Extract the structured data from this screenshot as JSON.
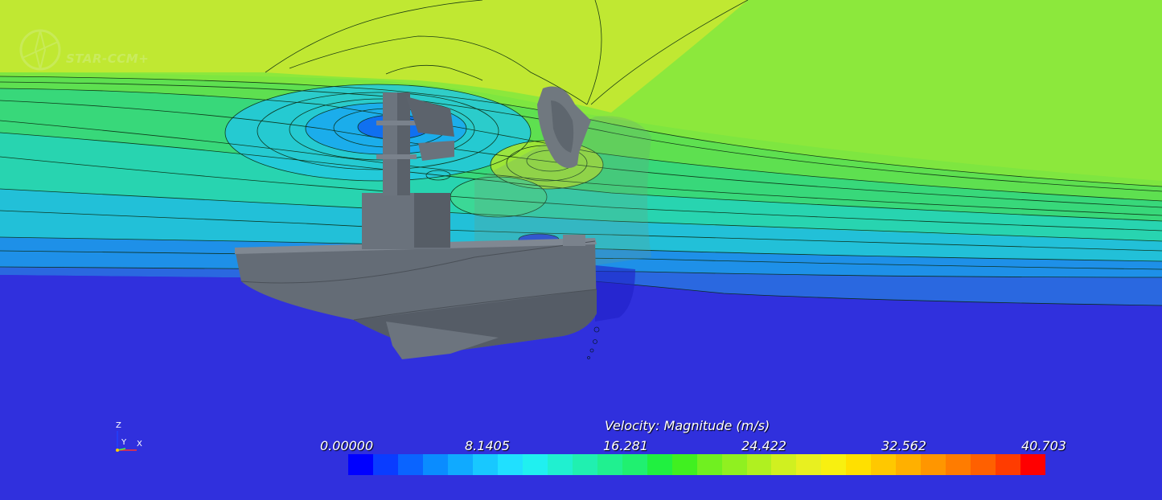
{
  "app": {
    "logo_text": "STAR-CCM+"
  },
  "axes": {
    "z_label": "Z",
    "y_label": "Y",
    "x_label": "X"
  },
  "legend": {
    "title": "Velocity: Magnitude (m/s)",
    "ticks": [
      "0.00000",
      "8.1405",
      "16.281",
      "24.422",
      "32.562",
      "40.703"
    ],
    "colors": [
      "#0000ff",
      "#0a3cff",
      "#0a64ff",
      "#0a8cff",
      "#10aaff",
      "#18c8ff",
      "#20e0ff",
      "#20f0f0",
      "#20f0d0",
      "#20f0b0",
      "#20f090",
      "#20f070",
      "#20f040",
      "#40f020",
      "#70f020",
      "#90f020",
      "#b0f020",
      "#d0f020",
      "#e8f020",
      "#f8f010",
      "#ffe000",
      "#ffc800",
      "#ffb000",
      "#ff9600",
      "#ff7c00",
      "#ff6000",
      "#ff3c00",
      "#ff0000"
    ],
    "min": 0.0,
    "max": 40.703
  },
  "scene": {
    "hull_color": "#646c76",
    "sky_color": "#7ee640",
    "water_color": "#3030dd"
  }
}
